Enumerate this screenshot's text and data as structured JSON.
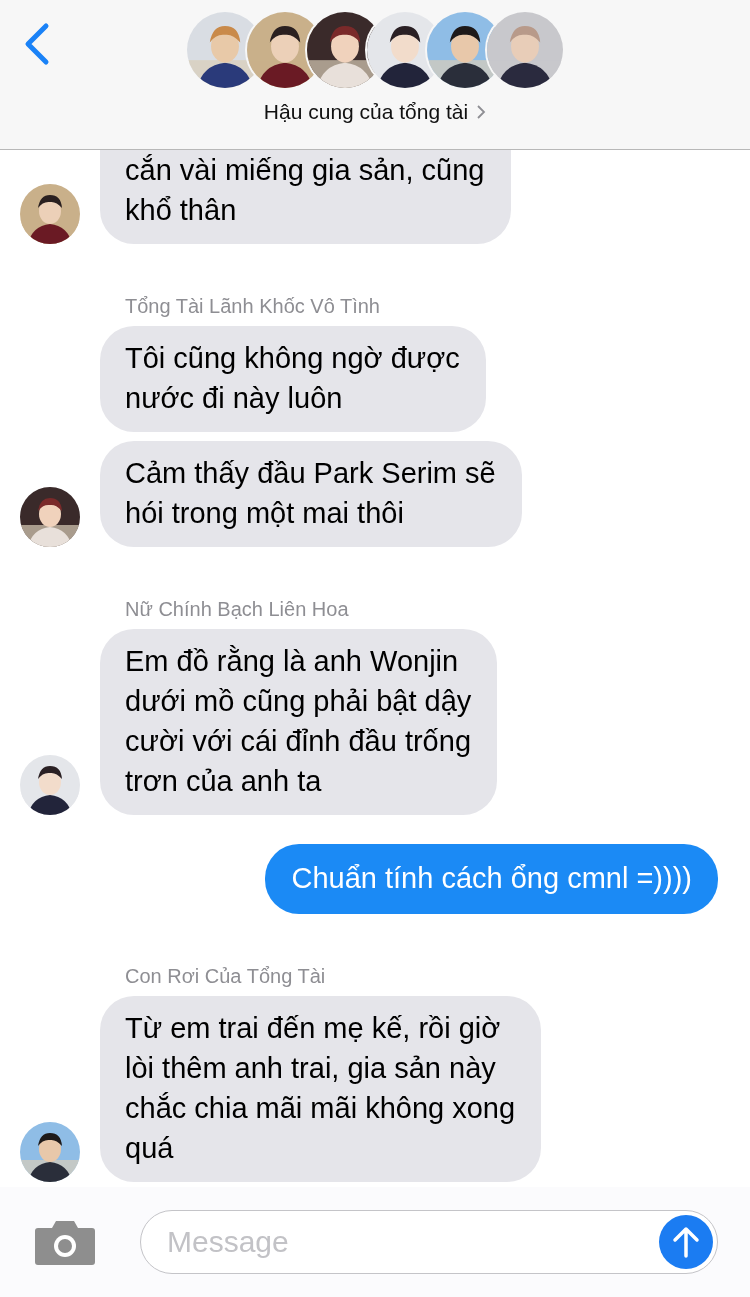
{
  "header": {
    "title": "Hậu cung của tổng tài"
  },
  "messages": [
    {
      "kind": "incoming",
      "bubbles": [
        [
          "cắn vài miếng gia sản, cũng",
          "khổ thân"
        ]
      ]
    },
    {
      "kind": "incoming",
      "sender": "Tổng Tài Lãnh Khốc Vô Tình",
      "bubbles": [
        [
          "Tôi cũng không ngờ được",
          "nước đi này luôn"
        ],
        [
          "Cảm thấy đầu Park Serim sẽ",
          "hói trong một mai thôi"
        ]
      ]
    },
    {
      "kind": "incoming",
      "sender": "Nữ Chính Bạch Liên Hoa",
      "bubbles": [
        [
          "Em đồ rằng là anh Wonjin",
          "dưới mồ cũng phải bật dậy",
          "cười với cái đỉnh đầu trống",
          "trơn của anh ta"
        ]
      ]
    },
    {
      "kind": "outgoing",
      "bubbles": [
        [
          "Chuẩn tính cách ổng cmnl =))))"
        ]
      ]
    },
    {
      "kind": "incoming",
      "sender": "Con Rơi Của Tổng Tài",
      "bubbles": [
        [
          "Từ em trai đến mẹ kế, rồi giờ",
          "lòi thêm anh trai, gia sản này",
          "chắc chia mãi mãi không xong",
          "quá"
        ]
      ]
    }
  ],
  "composer": {
    "placeholder": "Message"
  }
}
